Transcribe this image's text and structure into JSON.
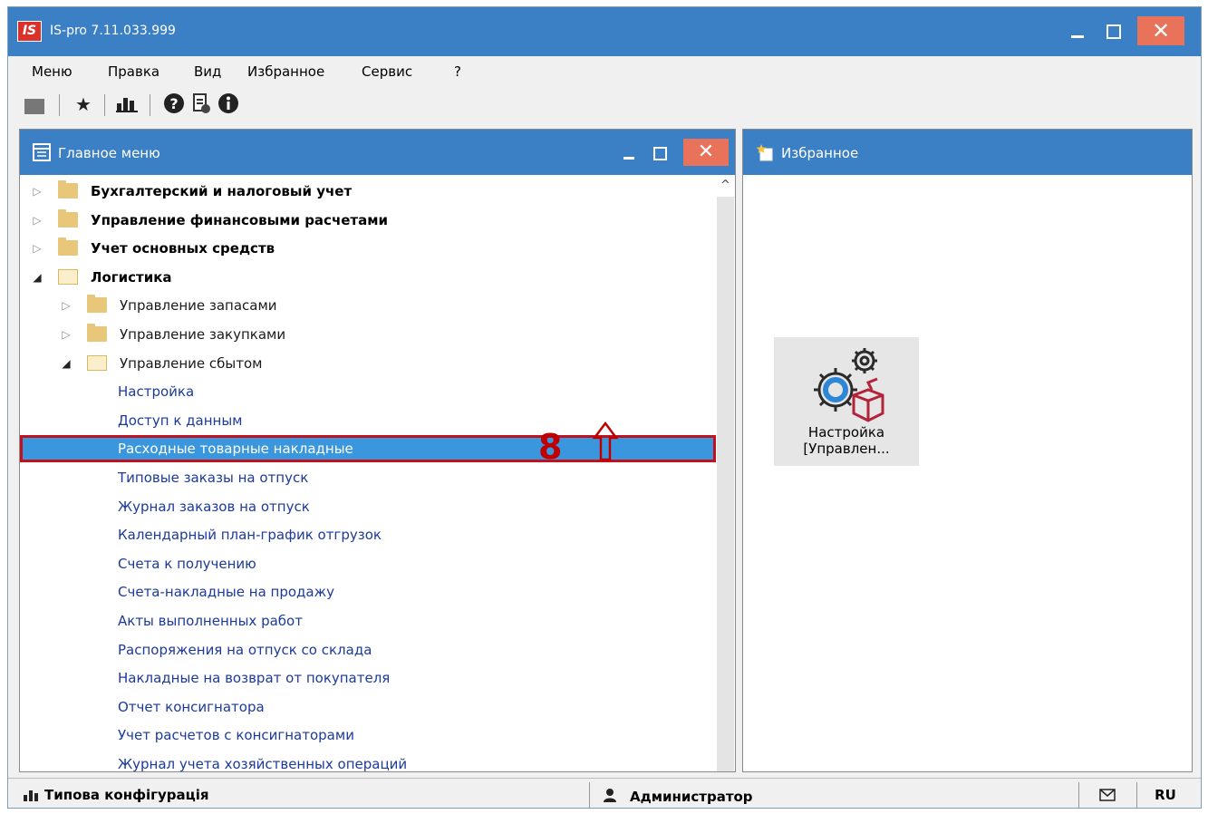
{
  "window": {
    "logo_text": "IS",
    "title": "IS-pro 7.11.033.999",
    "close_glyph": "✕"
  },
  "menubar": {
    "items": [
      "Меню",
      "Правка",
      "Вид",
      "Избранное",
      "Сервис",
      "?"
    ]
  },
  "toolbar": {
    "buttons": [
      "folder-icon",
      "star-icon",
      "chart-icon",
      "help-icon",
      "document-icon",
      "info-icon"
    ]
  },
  "main_menu": {
    "title": "Главное меню",
    "close_glyph": "✕",
    "tree": [
      {
        "label": "Бухгалтерский и налоговый учет",
        "level": 0,
        "kind": "folder",
        "expanded": false
      },
      {
        "label": "Управление финансовыми расчетами",
        "level": 0,
        "kind": "folder",
        "expanded": false
      },
      {
        "label": "Учет основных средств",
        "level": 0,
        "kind": "folder",
        "expanded": false
      },
      {
        "label": "Логистика",
        "level": 0,
        "kind": "folder",
        "expanded": true
      },
      {
        "label": "Управление запасами",
        "level": 1,
        "kind": "folder",
        "expanded": false
      },
      {
        "label": "Управление закупками",
        "level": 1,
        "kind": "folder",
        "expanded": false
      },
      {
        "label": "Управление сбытом",
        "level": 1,
        "kind": "folder",
        "expanded": true
      },
      {
        "label": "Настройка",
        "level": 2,
        "kind": "leaf"
      },
      {
        "label": "Доступ к данным",
        "level": 2,
        "kind": "leaf"
      },
      {
        "label": "Расходные товарные накладные",
        "level": 2,
        "kind": "leaf",
        "selected": true
      },
      {
        "label": "Типовые заказы на отпуск",
        "level": 2,
        "kind": "leaf"
      },
      {
        "label": "Журнал заказов на отпуск",
        "level": 2,
        "kind": "leaf"
      },
      {
        "label": "Календарный план-график отгрузок",
        "level": 2,
        "kind": "leaf"
      },
      {
        "label": "Счета к получению",
        "level": 2,
        "kind": "leaf"
      },
      {
        "label": "Счета-накладные на продажу",
        "level": 2,
        "kind": "leaf"
      },
      {
        "label": "Акты выполненных работ",
        "level": 2,
        "kind": "leaf"
      },
      {
        "label": "Распоряжения на отпуск со склада",
        "level": 2,
        "kind": "leaf"
      },
      {
        "label": "Накладные на возврат от покупателя",
        "level": 2,
        "kind": "leaf"
      },
      {
        "label": "Отчет консигнатора",
        "level": 2,
        "kind": "leaf"
      },
      {
        "label": "Учет расчетов с консигнаторами",
        "level": 2,
        "kind": "leaf"
      },
      {
        "label": "Журнал учета хозяйственных операций",
        "level": 2,
        "kind": "leaf"
      }
    ],
    "scroll_up_glyph": "^"
  },
  "favorites": {
    "title": "Избранное",
    "items": [
      {
        "line1": "Настройка",
        "line2": "[Управлен..."
      }
    ]
  },
  "annotation": {
    "step_number": "8"
  },
  "statusbar": {
    "config": "Типова конфігурація",
    "user": "Администратор",
    "lang": "RU"
  },
  "colors": {
    "titlebar": "#3b7fc4",
    "close_button": "#e8725a",
    "selection": "#3a96dd",
    "highlight_border": "#c0111c",
    "annotation": "#c00000",
    "leaf_text": "#1c3a9a"
  }
}
